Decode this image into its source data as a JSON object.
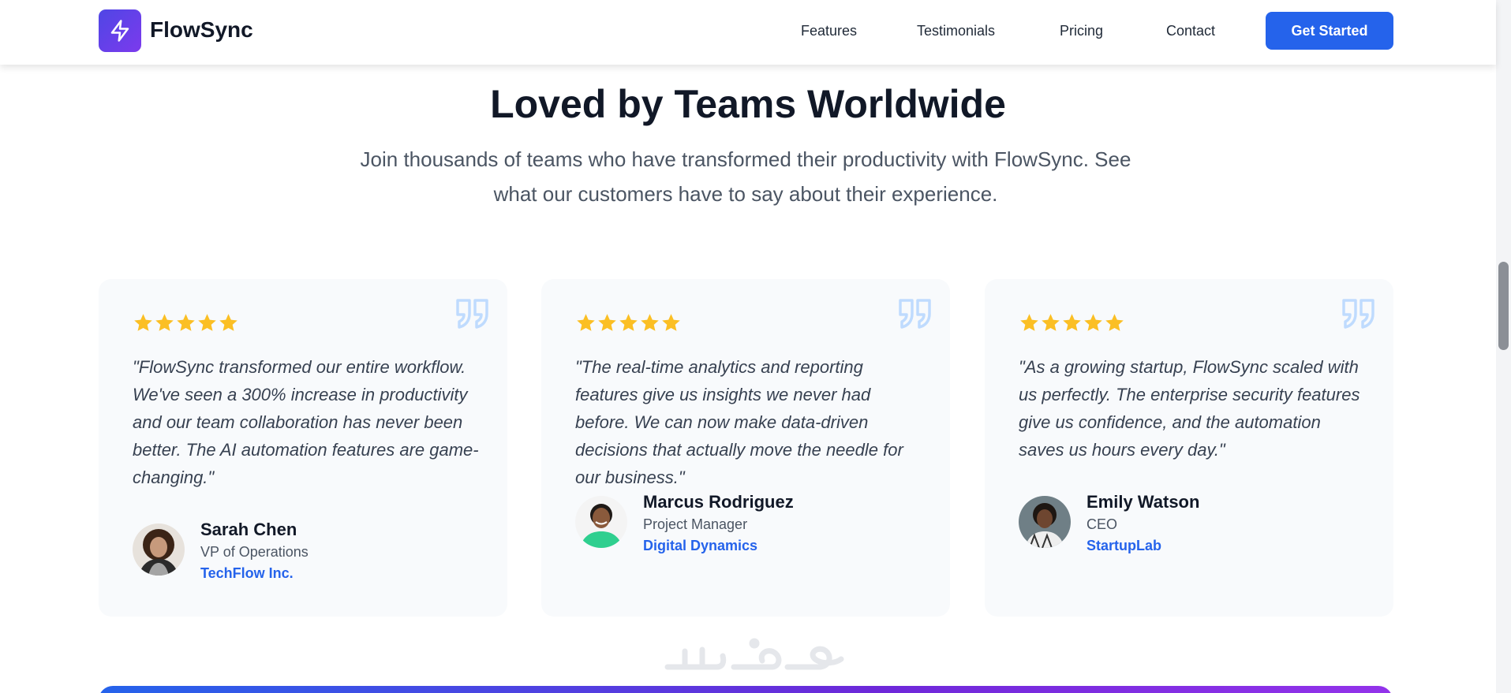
{
  "header": {
    "brand": "FlowSync",
    "nav": [
      "Features",
      "Testimonials",
      "Pricing",
      "Contact"
    ],
    "cta": "Get Started"
  },
  "section": {
    "title": "Loved by Teams Worldwide",
    "subtitle": "Join thousands of teams who have transformed their productivity with FlowSync. See what our customers have to say about their experience."
  },
  "testimonials": [
    {
      "rating": 5,
      "quote": "\"FlowSync transformed our entire workflow. We've seen a 300% increase in productivity and our team collaboration has never been better. The AI automation features are game-changing.\"",
      "name": "Sarah Chen",
      "role": "VP of Operations",
      "company": "TechFlow Inc."
    },
    {
      "rating": 5,
      "quote": "\"The real-time analytics and reporting features give us insights we never had before. We can now make data-driven decisions that actually move the needle for our business.\"",
      "name": "Marcus Rodriguez",
      "role": "Project Manager",
      "company": "Digital Dynamics"
    },
    {
      "rating": 5,
      "quote": "\"As a growing startup, FlowSync scaled with us perfectly. The enterprise security features give us confidence, and the automation saves us hours every day.\"",
      "name": "Emily Watson",
      "role": "CEO",
      "company": "StartupLab"
    }
  ],
  "watermark": "خمسات",
  "colors": {
    "accent": "#2563eb",
    "star": "#fbbf24",
    "quote_mark": "#bfdbfe",
    "card_bg": "#f8fafc"
  },
  "icons": {
    "logo": "lightning-bolt-icon",
    "rating": "star-icon",
    "quote": "quote-icon"
  }
}
